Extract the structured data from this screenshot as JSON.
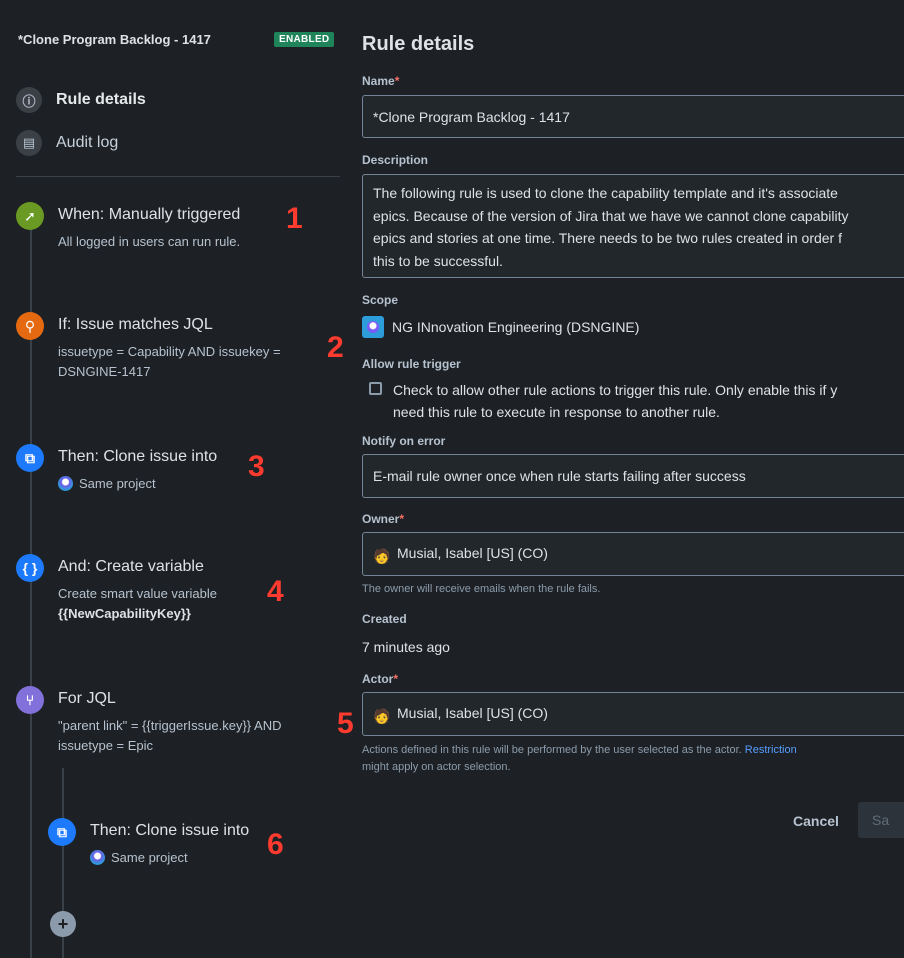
{
  "rule": {
    "title": "*Clone Program Backlog - 1417",
    "status_badge": "ENABLED"
  },
  "nav": {
    "rule_details": "Rule details",
    "audit_log": "Audit log"
  },
  "components": [
    {
      "title": "When: Manually triggered",
      "subtitle": "All logged in users can run rule.",
      "icon": "cursor-click-icon",
      "color": "#6a9a23"
    },
    {
      "title": "If: Issue matches JQL",
      "subtitle_line1": "issuetype = Capability AND issuekey =",
      "subtitle_line2": "DSNGINE-1417",
      "icon": "search-icon",
      "color": "#e56910"
    },
    {
      "title": "Then: Clone issue into",
      "subtitle": "Same project",
      "icon": "clone-icon",
      "color": "#1d7afc"
    },
    {
      "title": "And: Create variable",
      "subtitle_line1": "Create smart value variable",
      "subtitle_line2": "{{NewCapabilityKey}}",
      "icon": "braces-icon",
      "color": "#1d7afc"
    },
    {
      "title": "For JQL",
      "subtitle_line1": "\"parent link\" = {{triggerIssue.key}} AND",
      "subtitle_line2": "issuetype = Epic",
      "icon": "branch-icon",
      "color": "#8270db"
    },
    {
      "title": "Then: Clone issue into",
      "subtitle": "Same project",
      "icon": "clone-icon",
      "color": "#1d7afc"
    }
  ],
  "annotations": [
    "1",
    "2",
    "3",
    "4",
    "5",
    "6"
  ],
  "details": {
    "heading": "Rule details",
    "name_label": "Name",
    "name_value": "*Clone Program Backlog - 1417",
    "description_label": "Description",
    "description_lines": [
      "The following rule is used to clone the capability template and it's associate",
      "epics. Because of the version of Jira that we have we cannot clone capability",
      "epics and stories at one time. There needs to be two rules created in order f",
      "this to be successful."
    ],
    "scope_label": "Scope",
    "scope_value": "NG INnovation Engineering (DSNGINE)",
    "allow_trigger_label": "Allow rule trigger",
    "allow_trigger_line1": "Check to allow other rule actions to trigger this rule. Only enable this if y",
    "allow_trigger_line2": "need this rule to execute in response to another rule.",
    "notify_label": "Notify on error",
    "notify_value": "E-mail rule owner once when rule starts failing after success",
    "owner_label": "Owner",
    "owner_value": "Musial, Isabel [US] (CO)",
    "owner_help": "The owner will receive emails when the rule fails.",
    "created_label": "Created",
    "created_value": "7 minutes ago",
    "actor_label": "Actor",
    "actor_value": "Musial, Isabel [US] (CO)",
    "actor_help_line1": "Actions defined in this rule will be performed by the user selected as the actor.",
    "actor_help_link": "Restriction",
    "actor_help_line2": "might apply on actor selection.",
    "required_mark": "*"
  },
  "buttons": {
    "cancel": "Cancel",
    "save": "Sa"
  }
}
